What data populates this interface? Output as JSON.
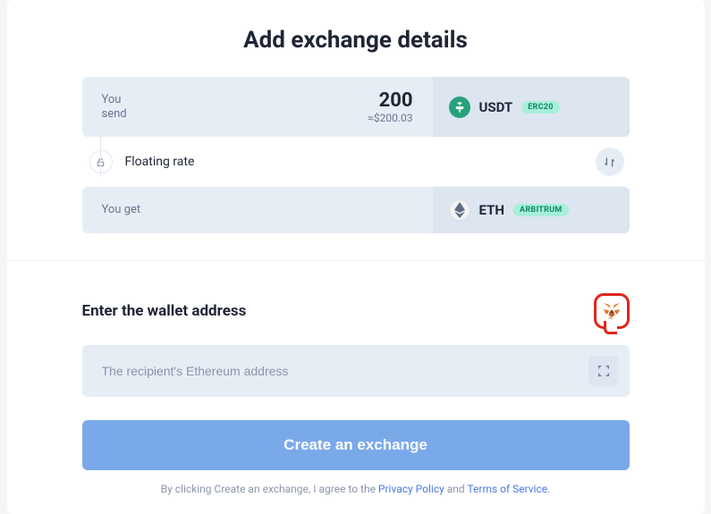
{
  "title": "Add exchange details",
  "send": {
    "label": "You\nsend",
    "amount": "200",
    "approx": "≈$200.03",
    "coin": "USDT",
    "badge": "ERC20"
  },
  "rate": {
    "label": "Floating rate"
  },
  "get": {
    "label": "You get",
    "coin": "ETH",
    "badge": "ARBITRUM"
  },
  "wallet": {
    "title": "Enter the wallet address",
    "placeholder": "The recipient's Ethereum address"
  },
  "cta": "Create an exchange",
  "terms": {
    "prefix": "By clicking Create an exchange, I agree to the ",
    "privacy": "Privacy Policy",
    "and": " and ",
    "tos": "Terms of Service",
    "suffix": "."
  }
}
